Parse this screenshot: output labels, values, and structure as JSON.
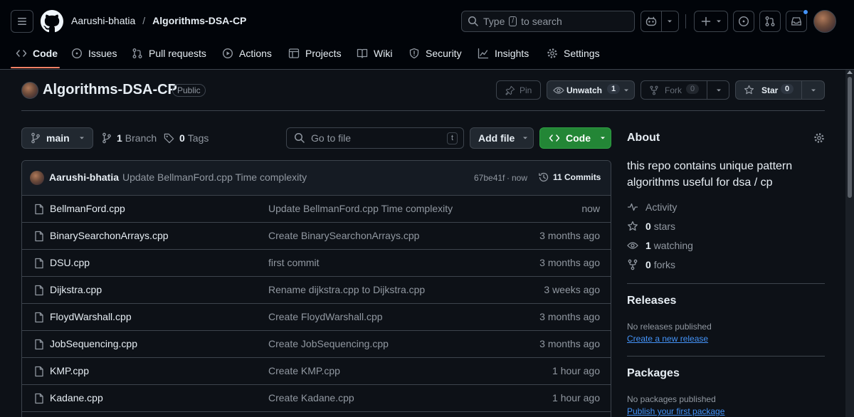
{
  "header": {
    "owner": "Aarushi-bhatia",
    "separator": "/",
    "repo": "Algorithms-DSA-CP",
    "search_prefix": "Type",
    "search_key": "/",
    "search_suffix": "to search"
  },
  "nav_tabs": [
    "Code",
    "Issues",
    "Pull requests",
    "Actions",
    "Projects",
    "Wiki",
    "Security",
    "Insights",
    "Settings"
  ],
  "repo_header": {
    "name": "Algorithms-DSA-CP",
    "visibility": "Public",
    "pin_label": "Pin",
    "unwatch_label": "Unwatch",
    "watch_count": "1",
    "fork_label": "Fork",
    "fork_count": "0",
    "star_label": "Star",
    "star_count": "0"
  },
  "toolbar": {
    "branch": "main",
    "branch_count": "1",
    "branch_label": "Branch",
    "tag_count": "0",
    "tag_label": "Tags",
    "goto_placeholder": "Go to file",
    "goto_key": "t",
    "add_file_label": "Add file",
    "code_label": "Code"
  },
  "commit": {
    "author": "Aarushi-bhatia",
    "message": "Update BellmanFord.cpp Time complexity",
    "sha": "67be41f",
    "sep": "·",
    "time": "now",
    "count_label": "11 Commits"
  },
  "files": [
    {
      "name": "BellmanFord.cpp",
      "message": "Update BellmanFord.cpp Time complexity",
      "time": "now"
    },
    {
      "name": "BinarySearchonArrays.cpp",
      "message": "Create BinarySearchonArrays.cpp",
      "time": "3 months ago"
    },
    {
      "name": "DSU.cpp",
      "message": "first commit",
      "time": "3 months ago"
    },
    {
      "name": "Dijkstra.cpp",
      "message": "Rename dijkstra.cpp to Dijkstra.cpp",
      "time": "3 weeks ago"
    },
    {
      "name": "FloydWarshall.cpp",
      "message": "Create FloydWarshall.cpp",
      "time": "3 months ago"
    },
    {
      "name": "JobSequencing.cpp",
      "message": "Create JobSequencing.cpp",
      "time": "3 months ago"
    },
    {
      "name": "KMP.cpp",
      "message": "Create KMP.cpp",
      "time": "1 hour ago"
    },
    {
      "name": "Kadane.cpp",
      "message": "Create Kadane.cpp",
      "time": "1 hour ago"
    }
  ],
  "about": {
    "heading": "About",
    "description_line1": "this repo contains unique pattern",
    "description_line2": "algorithms useful for dsa / cp",
    "activity": "Activity",
    "stars_count": "0",
    "stars_label": "stars",
    "watching_count": "1",
    "watching_label": "watching",
    "forks_count": "0",
    "forks_label": "forks"
  },
  "releases": {
    "heading": "Releases",
    "empty": "No releases published",
    "create_link": "Create a new release"
  },
  "packages": {
    "heading": "Packages",
    "empty": "No packages published",
    "publish_link": "Publish your first package"
  },
  "colors": {
    "background": "#0d1117",
    "header_bg": "#010409",
    "border": "#3d444d",
    "accent_green": "#238636",
    "link_blue": "#4493f8",
    "tab_underline": "#f78166"
  }
}
